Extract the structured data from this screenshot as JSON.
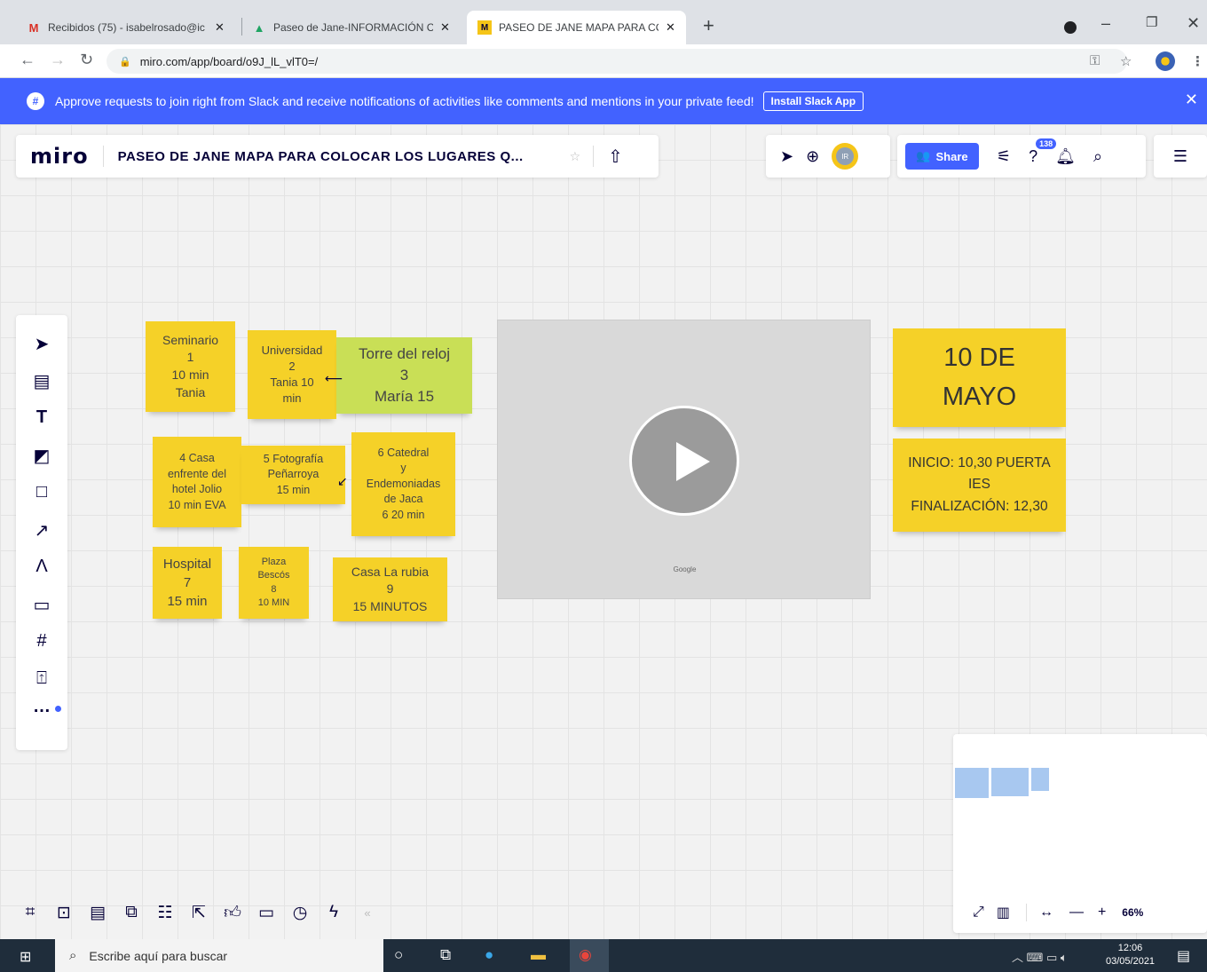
{
  "browser": {
    "tabs": [
      {
        "title": "Recibidos (75) - isabelrosado@ic",
        "icon": "gmail-icon",
        "color": "#d93025"
      },
      {
        "title": "Paseo de Jane-INFORMACIÓN C",
        "icon": "google-drive-icon",
        "color": "#1fa463"
      },
      {
        "title": "PASEO DE JANE MAPA PARA COL",
        "icon": "miro-icon",
        "color": "#f5c518"
      }
    ],
    "new_tab": "+",
    "url": "miro.com/app/board/o9J_lL_vlT0=/"
  },
  "banner": {
    "text": "Approve requests to join right from Slack and receive notifications of activities like comments and mentions in your private feed!",
    "button": "Install Slack App",
    "close": "✕"
  },
  "miro": {
    "logo": "miro",
    "board_title": "PASEO DE JANE MAPA PARA COLOCAR LOS LUGARES Q...",
    "share_label": "Share",
    "help_badge": "138",
    "user_initials": "IR",
    "zoom": "66%"
  },
  "stickies": [
    {
      "text": "Seminario\n1\n10 min\nTania"
    },
    {
      "text": "Universidad\n2\nTania 10\nmin"
    },
    {
      "text": "Torre del reloj\n3\nMaría 15"
    },
    {
      "text": "4 Casa\nenfrente del\nhotel Jolio\n10 min EVA"
    },
    {
      "text": "5 Fotografía\nPeñarroya\n15 min"
    },
    {
      "text": "6 Catedral\ny\nEndemoniadas\nde Jaca\n6 20 min"
    },
    {
      "text": "Hospital\n7\n15 min"
    },
    {
      "text": "Plaza\nBescós\n8\n10 MIN"
    },
    {
      "text": "Casa La rubia\n9\n15 MINUTOS"
    },
    {
      "text": "10 DE\nMAYO"
    },
    {
      "text": "INICIO: 10,30 PUERTA\nIES\nFINALIZACIÓN: 12,30"
    }
  ],
  "video": {
    "caption": "Google"
  },
  "taskbar": {
    "search_placeholder": "Escribe aquí para buscar",
    "time": "12:06",
    "date": "03/05/2021"
  }
}
